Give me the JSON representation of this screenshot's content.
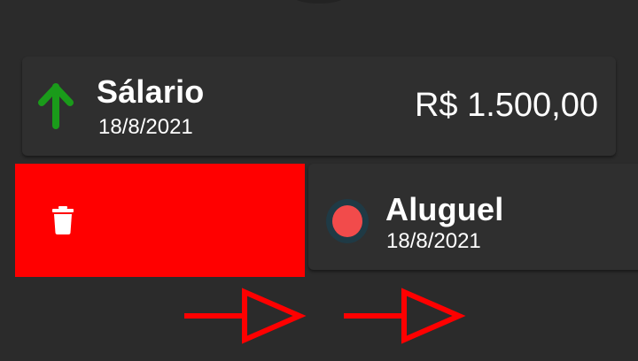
{
  "transactions": [
    {
      "title": "Sálario",
      "date": "18/8/2021",
      "amount": "R$ 1.500,00",
      "type": "income",
      "icon": "arrow-up-icon"
    },
    {
      "title": "Aluguel",
      "date": "18/8/2021",
      "amount": "",
      "type": "expense",
      "icon": "red-dot-icon"
    }
  ],
  "swipe_action": {
    "icon": "trash-icon",
    "color": "#ff0000"
  },
  "colors": {
    "background": "#2b2b2b",
    "card": "#2f2f2f",
    "income": "#1a9b1a",
    "expense_dot": "#f24b4b",
    "annotation": "#ff0000"
  },
  "annotations": {
    "icon": "arrow-right-icon",
    "count": 2
  }
}
